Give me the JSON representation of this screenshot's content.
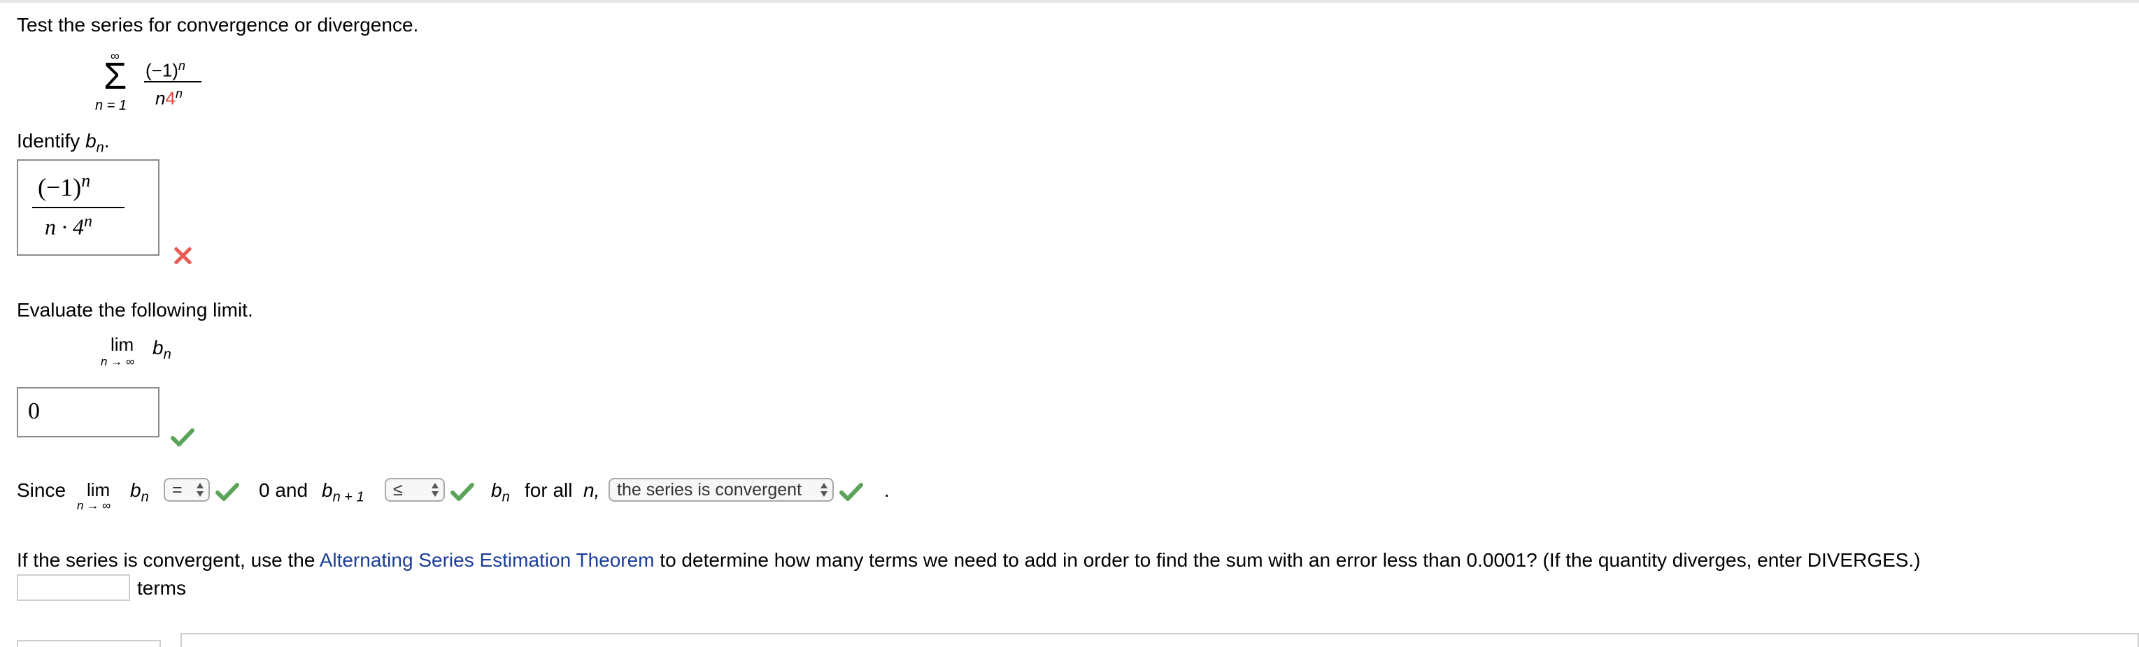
{
  "question": {
    "prompt": "Test the series for convergence or divergence.",
    "series": {
      "sigma_top": "∞",
      "sigma_symbol": "Σ",
      "sigma_bottom": "n = 1",
      "numerator": "(−1)",
      "numerator_exp": "n",
      "denominator_n": "n",
      "denominator_base": "4",
      "denominator_exp": "n"
    }
  },
  "part_bn": {
    "label_prefix": "Identify ",
    "label_var": "b",
    "label_sub": "n",
    "label_suffix": ".",
    "answer": {
      "numerator": "(−1)",
      "numerator_exp": "n",
      "denominator": "n · 4",
      "denominator_exp": "n"
    },
    "status": "incorrect"
  },
  "part_limit": {
    "label": "Evaluate the following limit.",
    "lim": "lim",
    "lim_sub": "n → ∞",
    "var": "b",
    "var_sub": "n",
    "answer": "0",
    "status": "correct"
  },
  "part_since": {
    "since": "Since",
    "lim": "lim",
    "lim_sub": "n → ∞",
    "var": "b",
    "var_sub": "n",
    "select1": "=",
    "zero_and": "0 and",
    "var2": "b",
    "var2_sub": "n + 1",
    "select2": "≤",
    "var3": "b",
    "var3_sub": "n",
    "for_all": "for all",
    "n_var": "n,",
    "select3": "the series is convergent",
    "period": "."
  },
  "part_terms": {
    "text_before": "If the series is convergent, use the ",
    "link": "Alternating Series Estimation Theorem",
    "text_after": " to determine how many terms we need to add in order to find the sum with an error less than 0.0001? (If the quantity diverges, enter DIVERGES.)",
    "input_value": "",
    "unit": "terms"
  },
  "colors": {
    "accent_red": "#e8433f",
    "check_green": "#5aa45a",
    "link_blue": "#1b3e97"
  }
}
